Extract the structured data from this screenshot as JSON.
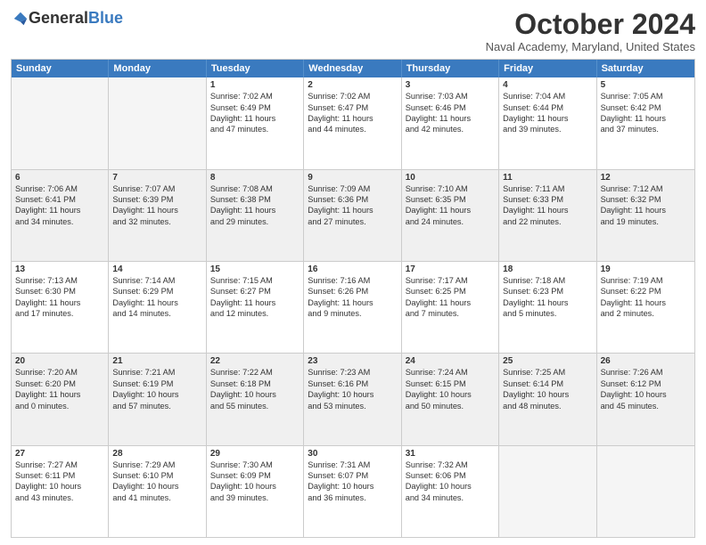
{
  "header": {
    "logo_general": "General",
    "logo_blue": "Blue",
    "title": "October 2024",
    "location": "Naval Academy, Maryland, United States"
  },
  "days_of_week": [
    "Sunday",
    "Monday",
    "Tuesday",
    "Wednesday",
    "Thursday",
    "Friday",
    "Saturday"
  ],
  "weeks": [
    [
      {
        "day": "",
        "empty": true
      },
      {
        "day": "",
        "empty": true
      },
      {
        "day": "1",
        "lines": [
          "Sunrise: 7:02 AM",
          "Sunset: 6:49 PM",
          "Daylight: 11 hours",
          "and 47 minutes."
        ]
      },
      {
        "day": "2",
        "lines": [
          "Sunrise: 7:02 AM",
          "Sunset: 6:47 PM",
          "Daylight: 11 hours",
          "and 44 minutes."
        ]
      },
      {
        "day": "3",
        "lines": [
          "Sunrise: 7:03 AM",
          "Sunset: 6:46 PM",
          "Daylight: 11 hours",
          "and 42 minutes."
        ]
      },
      {
        "day": "4",
        "lines": [
          "Sunrise: 7:04 AM",
          "Sunset: 6:44 PM",
          "Daylight: 11 hours",
          "and 39 minutes."
        ]
      },
      {
        "day": "5",
        "lines": [
          "Sunrise: 7:05 AM",
          "Sunset: 6:42 PM",
          "Daylight: 11 hours",
          "and 37 minutes."
        ]
      }
    ],
    [
      {
        "day": "6",
        "lines": [
          "Sunrise: 7:06 AM",
          "Sunset: 6:41 PM",
          "Daylight: 11 hours",
          "and 34 minutes."
        ]
      },
      {
        "day": "7",
        "lines": [
          "Sunrise: 7:07 AM",
          "Sunset: 6:39 PM",
          "Daylight: 11 hours",
          "and 32 minutes."
        ]
      },
      {
        "day": "8",
        "lines": [
          "Sunrise: 7:08 AM",
          "Sunset: 6:38 PM",
          "Daylight: 11 hours",
          "and 29 minutes."
        ]
      },
      {
        "day": "9",
        "lines": [
          "Sunrise: 7:09 AM",
          "Sunset: 6:36 PM",
          "Daylight: 11 hours",
          "and 27 minutes."
        ]
      },
      {
        "day": "10",
        "lines": [
          "Sunrise: 7:10 AM",
          "Sunset: 6:35 PM",
          "Daylight: 11 hours",
          "and 24 minutes."
        ]
      },
      {
        "day": "11",
        "lines": [
          "Sunrise: 7:11 AM",
          "Sunset: 6:33 PM",
          "Daylight: 11 hours",
          "and 22 minutes."
        ]
      },
      {
        "day": "12",
        "lines": [
          "Sunrise: 7:12 AM",
          "Sunset: 6:32 PM",
          "Daylight: 11 hours",
          "and 19 minutes."
        ]
      }
    ],
    [
      {
        "day": "13",
        "lines": [
          "Sunrise: 7:13 AM",
          "Sunset: 6:30 PM",
          "Daylight: 11 hours",
          "and 17 minutes."
        ]
      },
      {
        "day": "14",
        "lines": [
          "Sunrise: 7:14 AM",
          "Sunset: 6:29 PM",
          "Daylight: 11 hours",
          "and 14 minutes."
        ]
      },
      {
        "day": "15",
        "lines": [
          "Sunrise: 7:15 AM",
          "Sunset: 6:27 PM",
          "Daylight: 11 hours",
          "and 12 minutes."
        ]
      },
      {
        "day": "16",
        "lines": [
          "Sunrise: 7:16 AM",
          "Sunset: 6:26 PM",
          "Daylight: 11 hours",
          "and 9 minutes."
        ]
      },
      {
        "day": "17",
        "lines": [
          "Sunrise: 7:17 AM",
          "Sunset: 6:25 PM",
          "Daylight: 11 hours",
          "and 7 minutes."
        ]
      },
      {
        "day": "18",
        "lines": [
          "Sunrise: 7:18 AM",
          "Sunset: 6:23 PM",
          "Daylight: 11 hours",
          "and 5 minutes."
        ]
      },
      {
        "day": "19",
        "lines": [
          "Sunrise: 7:19 AM",
          "Sunset: 6:22 PM",
          "Daylight: 11 hours",
          "and 2 minutes."
        ]
      }
    ],
    [
      {
        "day": "20",
        "lines": [
          "Sunrise: 7:20 AM",
          "Sunset: 6:20 PM",
          "Daylight: 11 hours",
          "and 0 minutes."
        ]
      },
      {
        "day": "21",
        "lines": [
          "Sunrise: 7:21 AM",
          "Sunset: 6:19 PM",
          "Daylight: 10 hours",
          "and 57 minutes."
        ]
      },
      {
        "day": "22",
        "lines": [
          "Sunrise: 7:22 AM",
          "Sunset: 6:18 PM",
          "Daylight: 10 hours",
          "and 55 minutes."
        ]
      },
      {
        "day": "23",
        "lines": [
          "Sunrise: 7:23 AM",
          "Sunset: 6:16 PM",
          "Daylight: 10 hours",
          "and 53 minutes."
        ]
      },
      {
        "day": "24",
        "lines": [
          "Sunrise: 7:24 AM",
          "Sunset: 6:15 PM",
          "Daylight: 10 hours",
          "and 50 minutes."
        ]
      },
      {
        "day": "25",
        "lines": [
          "Sunrise: 7:25 AM",
          "Sunset: 6:14 PM",
          "Daylight: 10 hours",
          "and 48 minutes."
        ]
      },
      {
        "day": "26",
        "lines": [
          "Sunrise: 7:26 AM",
          "Sunset: 6:12 PM",
          "Daylight: 10 hours",
          "and 45 minutes."
        ]
      }
    ],
    [
      {
        "day": "27",
        "lines": [
          "Sunrise: 7:27 AM",
          "Sunset: 6:11 PM",
          "Daylight: 10 hours",
          "and 43 minutes."
        ]
      },
      {
        "day": "28",
        "lines": [
          "Sunrise: 7:29 AM",
          "Sunset: 6:10 PM",
          "Daylight: 10 hours",
          "and 41 minutes."
        ]
      },
      {
        "day": "29",
        "lines": [
          "Sunrise: 7:30 AM",
          "Sunset: 6:09 PM",
          "Daylight: 10 hours",
          "and 39 minutes."
        ]
      },
      {
        "day": "30",
        "lines": [
          "Sunrise: 7:31 AM",
          "Sunset: 6:07 PM",
          "Daylight: 10 hours",
          "and 36 minutes."
        ]
      },
      {
        "day": "31",
        "lines": [
          "Sunrise: 7:32 AM",
          "Sunset: 6:06 PM",
          "Daylight: 10 hours",
          "and 34 minutes."
        ]
      },
      {
        "day": "",
        "empty": true
      },
      {
        "day": "",
        "empty": true
      }
    ]
  ]
}
